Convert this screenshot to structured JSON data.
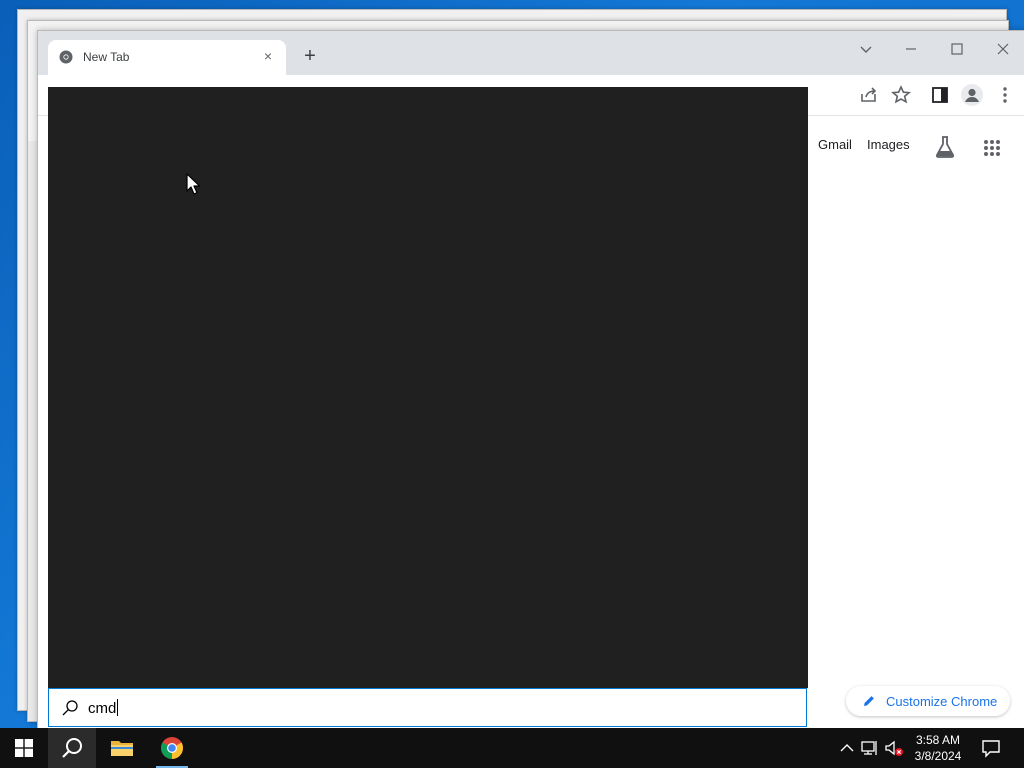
{
  "browser": {
    "tab": {
      "title": "New Tab",
      "close_symbol": "×"
    },
    "new_tab_symbol": "+",
    "google_links": {
      "gmail": "Gmail",
      "images": "Images"
    },
    "customize_label": "Customize Chrome"
  },
  "start_search": {
    "query": "cmd"
  },
  "taskbar": {
    "time": "3:58 AM",
    "date": "3/8/2024"
  },
  "colors": {
    "desktop": "#1378d6",
    "search_panel": "#202020",
    "accent": "#0078d4",
    "chrome_link": "#1a73e8"
  },
  "icons": [
    "chrome-logo-icon",
    "close-icon",
    "plus-icon",
    "chevron-down-icon",
    "minimize-icon",
    "maximize-icon",
    "window-close-icon",
    "share-icon",
    "star-icon",
    "side-panel-icon",
    "profile-icon",
    "more-vert-icon",
    "labs-flask-icon",
    "apps-grid-icon",
    "pencil-icon",
    "search-icon",
    "windows-start-icon",
    "file-explorer-icon",
    "network-icon",
    "volume-muted-icon",
    "notification-icon",
    "chevron-up-icon"
  ]
}
